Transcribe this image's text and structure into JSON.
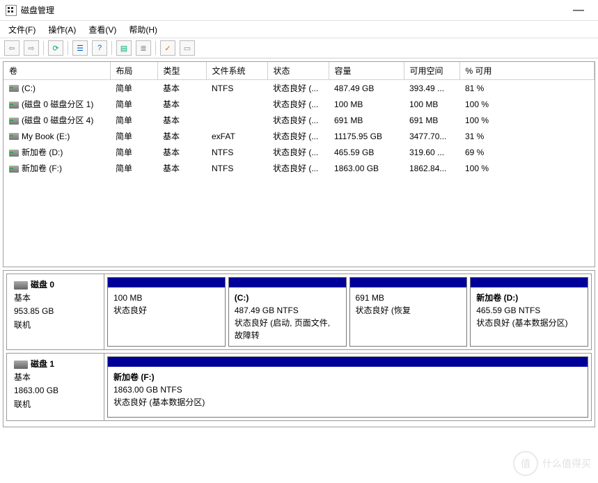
{
  "window": {
    "title": "磁盘管理"
  },
  "menubar": {
    "file": "文件(F)",
    "action": "操作(A)",
    "view": "查看(V)",
    "help": "帮助(H)"
  },
  "columns": {
    "volume": "卷",
    "layout": "布局",
    "type": "类型",
    "filesystem": "文件系统",
    "status": "状态",
    "capacity": "容量",
    "free": "可用空间",
    "pct": "% 可用"
  },
  "volumes": [
    {
      "name": "(C:)",
      "layout": "简单",
      "type": "基本",
      "fs": "NTFS",
      "status": "状态良好 (...",
      "capacity": "487.49 GB",
      "free": "393.49 ...",
      "pct": "81 %"
    },
    {
      "name": "(磁盘 0 磁盘分区 1)",
      "layout": "简单",
      "type": "基本",
      "fs": "",
      "status": "状态良好 (...",
      "capacity": "100 MB",
      "free": "100 MB",
      "pct": "100 %"
    },
    {
      "name": "(磁盘 0 磁盘分区 4)",
      "layout": "简单",
      "type": "基本",
      "fs": "",
      "status": "状态良好 (...",
      "capacity": "691 MB",
      "free": "691 MB",
      "pct": "100 %"
    },
    {
      "name": "My Book (E:)",
      "layout": "简单",
      "type": "基本",
      "fs": "exFAT",
      "status": "状态良好 (...",
      "capacity": "11175.95 GB",
      "free": "3477.70...",
      "pct": "31 %"
    },
    {
      "name": "新加卷 (D:)",
      "layout": "简单",
      "type": "基本",
      "fs": "NTFS",
      "status": "状态良好 (...",
      "capacity": "465.59 GB",
      "free": "319.60 ...",
      "pct": "69 %"
    },
    {
      "name": "新加卷 (F:)",
      "layout": "简单",
      "type": "基本",
      "fs": "NTFS",
      "status": "状态良好 (...",
      "capacity": "1863.00 GB",
      "free": "1862.84...",
      "pct": "100 %"
    }
  ],
  "disks": [
    {
      "name": "磁盘 0",
      "type": "基本",
      "capacity": "953.85 GB",
      "state": "联机",
      "partitions": [
        {
          "name": "",
          "size": "100 MB",
          "status": "状态良好"
        },
        {
          "name": "(C:)",
          "size": "487.49 GB NTFS",
          "status": "状态良好 (启动, 页面文件, 故障转"
        },
        {
          "name": "",
          "size": "691 MB",
          "status": "状态良好 (恢复"
        },
        {
          "name": "新加卷 (D:)",
          "size": "465.59 GB NTFS",
          "status": "状态良好 (基本数据分区)"
        }
      ]
    },
    {
      "name": "磁盘 1",
      "type": "基本",
      "capacity": "1863.00 GB",
      "state": "联机",
      "partitions": [
        {
          "name": "新加卷 (F:)",
          "size": "1863.00 GB NTFS",
          "status": "状态良好 (基本数据分区)"
        }
      ]
    }
  ],
  "watermark": {
    "circle": "值",
    "text": "什么值得买"
  }
}
